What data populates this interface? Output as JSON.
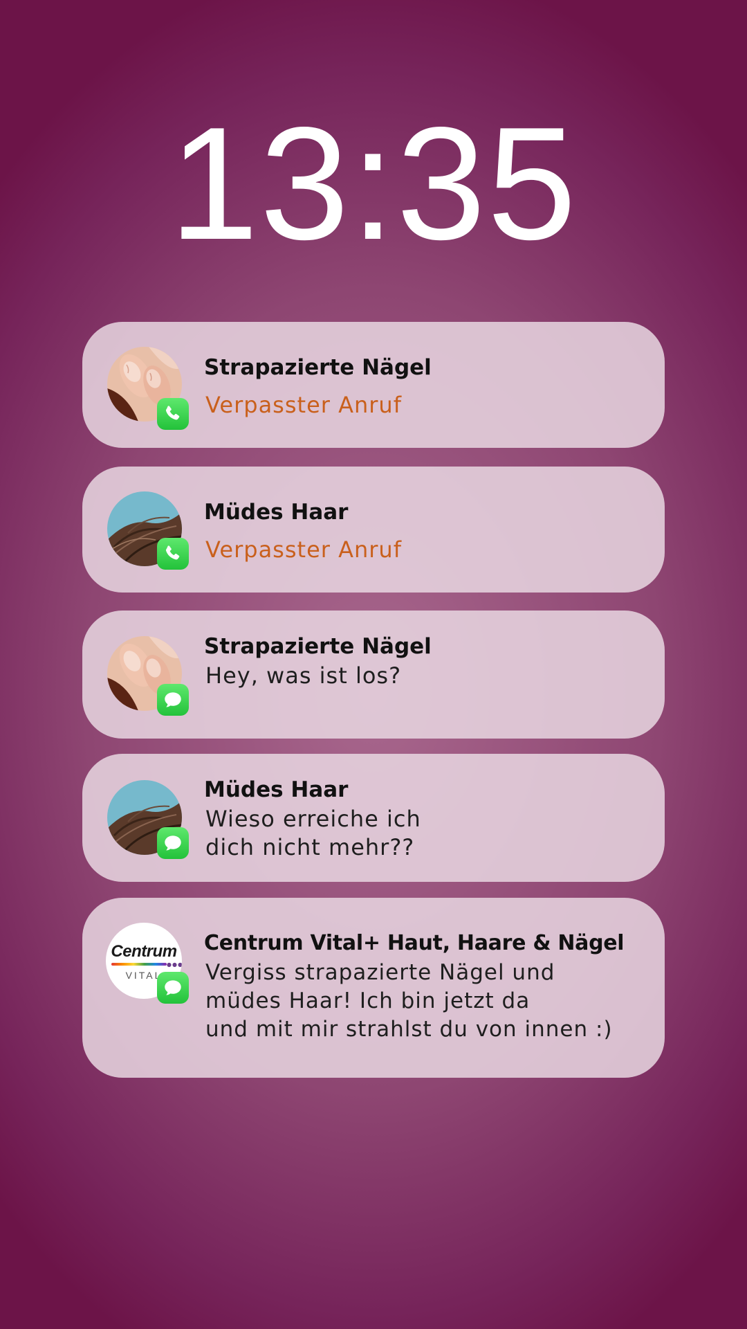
{
  "lockscreen": {
    "time": "13:35"
  },
  "notifications": [
    {
      "sender": "Strapazierte Nägel",
      "body": "Verpasster Anruf",
      "type": "call",
      "avatar": "nails-photo",
      "badge": "phone-icon"
    },
    {
      "sender": "Müdes Haar",
      "body": "Verpasster Anruf",
      "type": "call",
      "avatar": "hair-photo",
      "badge": "phone-icon"
    },
    {
      "sender": "Strapazierte Nägel",
      "body": "Hey, was ist los?",
      "type": "message",
      "avatar": "nails-photo",
      "badge": "message-icon"
    },
    {
      "sender": "Müdes Haar",
      "body": "Wieso erreiche ich\ndich nicht mehr??",
      "type": "message",
      "avatar": "hair-photo",
      "badge": "message-icon"
    },
    {
      "sender": "Centrum Vital+ Haut, Haare & Nägel",
      "body": "Vergiss strapazierte Nägel und\nmüdes Haar! Ich bin jetzt da\nund mit mir strahlst du von innen :)",
      "type": "message",
      "avatar": "centrum-logo",
      "badge": "message-icon",
      "logo_text": "Centrum",
      "logo_subtext": "VITAL"
    }
  ],
  "colors": {
    "missed_call": "#c9601c",
    "badge_green": "#34c759",
    "background": "#8e4672"
  }
}
